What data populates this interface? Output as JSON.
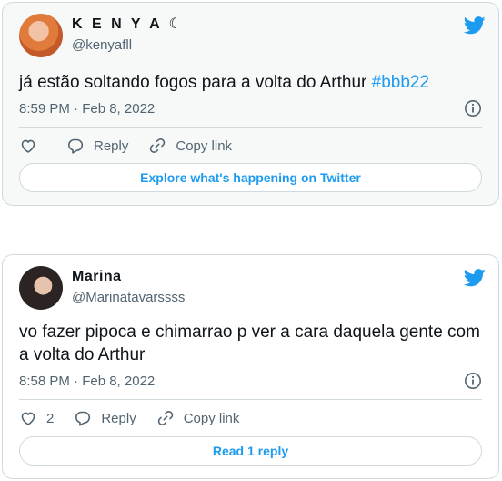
{
  "tweets": [
    {
      "author": {
        "name": "K E N Y A ☾",
        "handle": "@kenyafll"
      },
      "text": "já estão soltando fogos para a volta do Arthur ",
      "hashtag": "#bbb22",
      "timestamp": "8:59 PM · Feb 8, 2022",
      "like_count": "",
      "reply_label": "Reply",
      "copy_link_label": "Copy link",
      "cta_label": "Explore what's happening on Twitter"
    },
    {
      "author": {
        "name": "Marina",
        "handle": "@Marinatavarssss"
      },
      "text": "vo fazer pipoca e chimarrao p ver a cara daquela gente com a volta do Arthur",
      "timestamp": "8:58 PM · Feb 8, 2022",
      "like_count": "2",
      "reply_label": "Reply",
      "copy_link_label": "Copy link",
      "cta_label": "Read 1 reply"
    }
  ],
  "icons": {
    "twitter": "twitter-bird-icon",
    "info": "info-icon",
    "like": "heart-icon",
    "reply": "reply-icon",
    "copy_link": "link-icon"
  },
  "colors": {
    "accent": "#1d9bf0",
    "muted": "#536471",
    "border": "#cfd9de"
  }
}
